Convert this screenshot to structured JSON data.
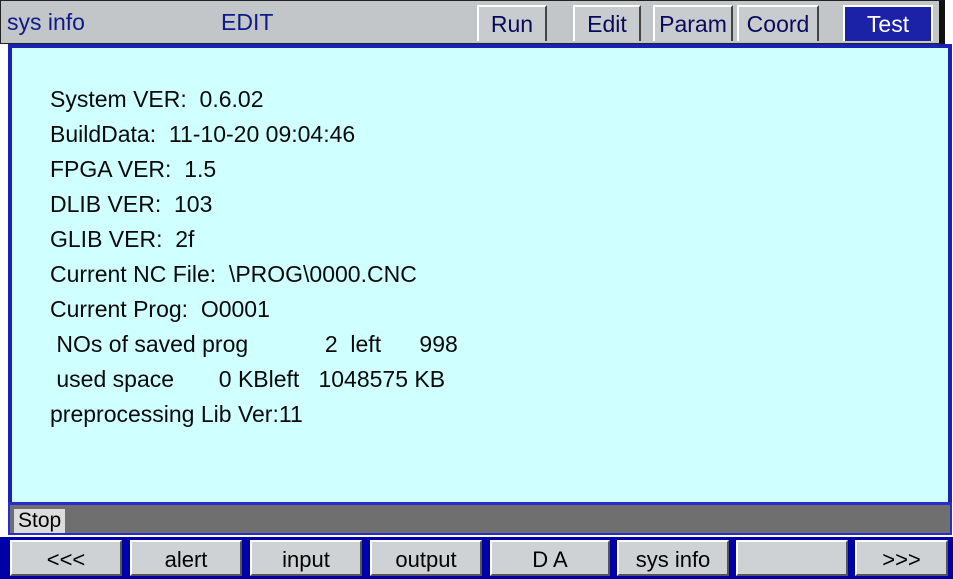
{
  "header": {
    "sys_title": "sys info",
    "mode": "EDIT",
    "tabs": [
      "Run",
      "Edit",
      "Param",
      "Coord",
      "Test"
    ],
    "selected_tab": "Test"
  },
  "info": {
    "lines": [
      "System VER:  0.6.02",
      "BuildData:  11-10-20 09:04:46",
      "FPGA VER:  1.5",
      "DLIB VER:  103",
      "GLIB VER:  2f",
      "Current NC File:  \\PROG\\0000.CNC",
      "Current Prog:  O0001",
      " NOs of saved prog            2  left      998",
      " used space       0 KBleft   1048575 KB",
      "preprocessing Lib Ver:11"
    ]
  },
  "status": {
    "text": "Stop"
  },
  "softkeys": [
    "<<<",
    "alert",
    "input",
    "output",
    "D A",
    "sys info",
    "",
    ">>>"
  ],
  "colors": {
    "panel_bg": "#cfffff",
    "accent_blue": "#1a22b4",
    "header_bg": "#c3c6c8"
  }
}
